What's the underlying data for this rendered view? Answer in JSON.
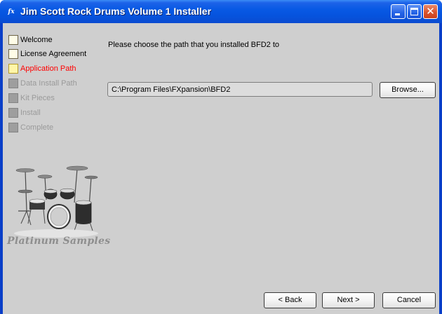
{
  "window": {
    "title": "Jim Scott Rock Drums Volume 1 Installer",
    "app_icon": "fx"
  },
  "steps": [
    {
      "label": "Welcome",
      "state": "done"
    },
    {
      "label": "License Agreement",
      "state": "done"
    },
    {
      "label": "Application Path",
      "state": "active"
    },
    {
      "label": "Data Install Path",
      "state": "pending"
    },
    {
      "label": "Kit Pieces",
      "state": "pending"
    },
    {
      "label": "Install",
      "state": "pending"
    },
    {
      "label": "Complete",
      "state": "pending"
    }
  ],
  "brand": {
    "text": "Platinum Samples"
  },
  "main": {
    "prompt": "Please choose the path that you installed BFD2 to",
    "path_value": "C:\\Program Files\\FXpansion\\BFD2",
    "browse_label": "Browse..."
  },
  "footer": {
    "back_label": "< Back",
    "next_label": "Next >",
    "cancel_label": "Cancel"
  },
  "colors": {
    "titlebar": "#0653dd",
    "client_background": "#cfcfcf",
    "active_step": "#ff0000",
    "pending_step": "#9a9a9a"
  },
  "icons": {
    "minimize": "minimize-icon",
    "maximize": "maximize-icon",
    "close": "close-icon"
  }
}
